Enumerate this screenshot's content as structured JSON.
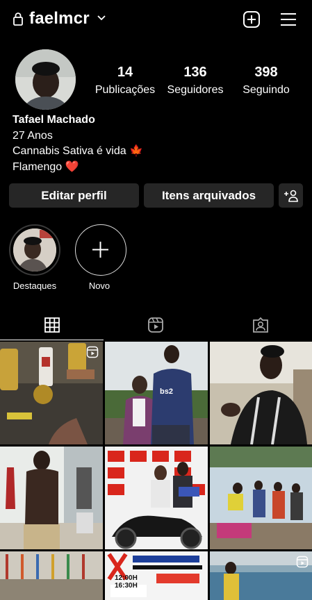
{
  "header": {
    "username": "faelmcr",
    "icons": [
      "lock-icon",
      "chevron-down-icon",
      "new-post-icon",
      "menu-icon"
    ]
  },
  "profile": {
    "stats": [
      {
        "value": "14",
        "label": "Publicações"
      },
      {
        "value": "136",
        "label": "Seguidores"
      },
      {
        "value": "398",
        "label": "Seguindo"
      }
    ],
    "name": "Tafael Machado",
    "bio_lines": [
      "27 Anos",
      "Cannabis Sativa é vida 🍁",
      "Flamengo ❤️"
    ]
  },
  "actions": {
    "edit_label": "Editar perfil",
    "archive_label": "Itens arquivados"
  },
  "highlights": [
    {
      "label": "Destaques"
    },
    {
      "label": "Novo"
    }
  ],
  "tabs": [
    "grid-icon",
    "reels-icon",
    "tagged-icon"
  ],
  "posts": [
    {
      "badge": "reel",
      "text": ""
    },
    {
      "badge": "",
      "text": "bs2"
    },
    {
      "badge": "",
      "text": ""
    },
    {
      "badge": "",
      "text": ""
    },
    {
      "badge": "",
      "text": ""
    },
    {
      "badge": "",
      "text": ""
    },
    {
      "badge": "",
      "text": ""
    },
    {
      "badge": "",
      "text": "12:00H 16:30H"
    },
    {
      "badge": "reel",
      "text": ""
    }
  ],
  "colors": {
    "background": "#000000",
    "button": "#262626",
    "text": "#ffffff",
    "heart": "#e1163c",
    "leaf": "#d63b1a"
  }
}
